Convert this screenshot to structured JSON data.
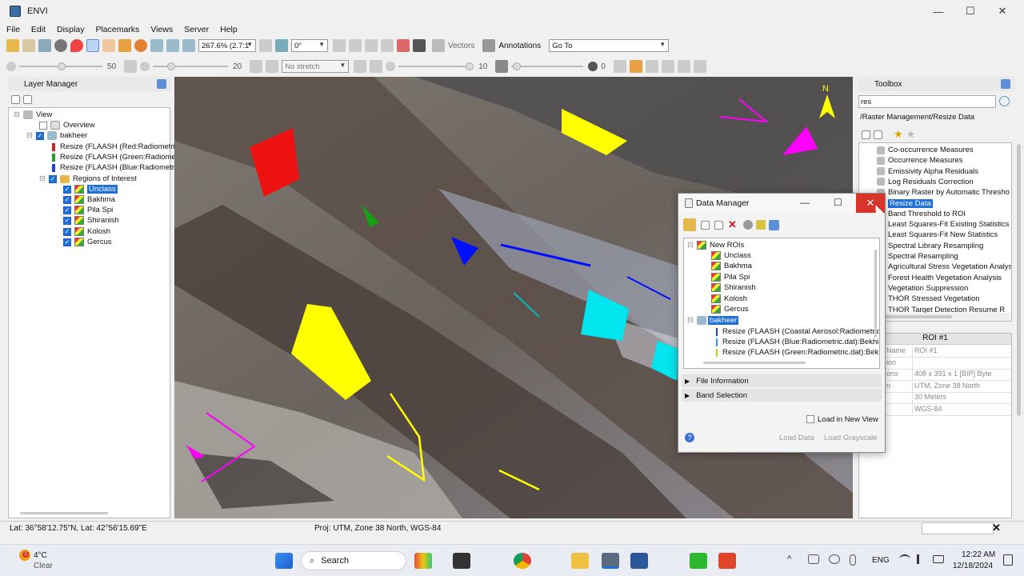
{
  "window": {
    "title": "ENVI",
    "minimize": "—",
    "maximize": "☐",
    "close": "✕"
  },
  "menu": [
    "File",
    "Edit",
    "Display",
    "Placemarks",
    "Views",
    "Server",
    "Help"
  ],
  "toolbar1": {
    "zoom": "267.6% (2.7:1",
    "rotation": "0°",
    "vectors": "Vectors",
    "annotations": "Annotations",
    "goto": "Go To"
  },
  "toolbar2": {
    "brightness": "50",
    "contrast": "20",
    "stretch": "No stretch",
    "sharpen": "10",
    "transparency": "0"
  },
  "layer_manager": {
    "title": "Layer Manager",
    "root": "View",
    "overview": "Overview",
    "dataset": "bakheer",
    "bands": [
      {
        "label": "Resize (FLAASH (Red:Radiometri",
        "color": "#d02020"
      },
      {
        "label": "Resize (FLAASH (Green:Radiome",
        "color": "#20a020"
      },
      {
        "label": "Resize (FLAASH (Blue:Radiometri",
        "color": "#2040d0"
      }
    ],
    "roi_group": "Regions of Interest",
    "rois": [
      "Unclass",
      "Bakhma",
      "Pila Spi",
      "Shiranish",
      "Kolosh",
      "Gercus"
    ]
  },
  "toolbox": {
    "title": "Toolbox",
    "search": "res",
    "path": "/Raster Management/Resize Data",
    "items": [
      "Co-occurrence Measures",
      "Occurrence Measures",
      "Emissivity Alpha Residuals",
      "Log Residuals Correction",
      "Binary Raster by Automatic Thresho",
      "Resize Data",
      "Band Threshold to ROI",
      "Least Squares-Fit Existing Statistics",
      "Least Squares-Fit New Statistics",
      "Spectral Library Resampling",
      "Spectral Resampling",
      "Agricultural Stress Vegetation Analys",
      "Forest Health Vegetation Analysis",
      "Vegetation Suppression",
      "THOR Stressed Vegetation",
      "THOR Target Detection Resume R",
      "THOR Target Detection Resume R"
    ],
    "selected": "Resize Data"
  },
  "roi_props": {
    "header": "ROI #1",
    "rows": [
      {
        "k": "Name",
        "v": "ROI #1"
      },
      {
        "k": "ion",
        "v": ""
      },
      {
        "k": "ons",
        "v": "408 x 391 x 1 [BIP] Byte"
      },
      {
        "k": "n",
        "v": "UTM, Zone 38 North"
      },
      {
        "k": "",
        "v": "30 Meters"
      },
      {
        "k": "",
        "v": "WGS-84"
      }
    ]
  },
  "data_manager": {
    "title": "Data Manager",
    "new_rois": "New ROIs",
    "rois": [
      "Unclass",
      "Bakhma",
      "Pila Spi",
      "Shiranish",
      "Kolosh",
      "Gercus"
    ],
    "dataset": "bakheer",
    "bands": [
      {
        "label": "Resize (FLAASH (Coastal Aerosol:Radiometric",
        "color": "#2040d0"
      },
      {
        "label": "Resize (FLAASH (Blue:Radiometric.dat):Bekhi",
        "color": "#20a0e0"
      },
      {
        "label": "Resize (FLAASH (Green:Radiometric.dat):Bekl",
        "color": "#c0d020"
      }
    ],
    "file_info": "File Information",
    "band_selection": "Band Selection",
    "load_new_view": "Load in New View",
    "load_data": "Load Data",
    "load_grayscale": "Load Grayscale"
  },
  "status": {
    "latlon": "Lat: 36°58'12.75\"N, Lat: 42°56'15.69\"E",
    "proj": "Proj: UTM, Zone 38 North, WGS-84"
  },
  "taskbar": {
    "temp": "4°C",
    "weather": "Clear",
    "search": "Search",
    "lang": "ENG",
    "time": "12:22 AM",
    "date": "12/18/2024"
  },
  "colors": {
    "accent": "#1e6fd9",
    "close_red": "#d9342b",
    "roi_yellow": "#ffff00",
    "roi_cyan": "#00e5ee",
    "roi_magenta": "#ff00ff",
    "roi_red": "#ee1111",
    "roi_blue": "#0010ff",
    "roi_green": "#15a015"
  }
}
